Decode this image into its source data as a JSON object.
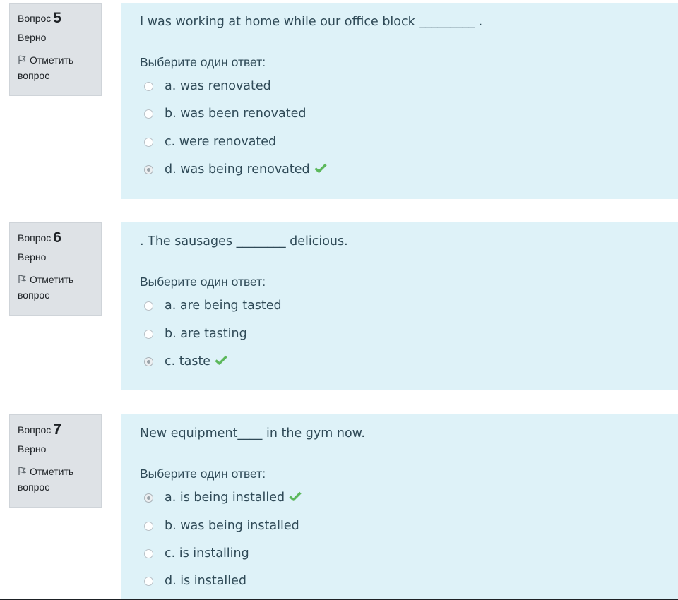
{
  "questions": [
    {
      "label": "Вопрос",
      "number": "5",
      "state": "Верно",
      "flag_label": "Отметить",
      "flag_label2": "вопрос",
      "text": "I was working at home while our office block   _________ .",
      "prompt": "Выберите один ответ:",
      "answers": [
        {
          "text": "a. was renovated",
          "checked": false,
          "correct": false
        },
        {
          "text": "b. was been renovated",
          "checked": false,
          "correct": false
        },
        {
          "text": "c. were renovated",
          "checked": false,
          "correct": false
        },
        {
          "text": "d. was being renovated",
          "checked": true,
          "correct": true
        }
      ]
    },
    {
      "label": "Вопрос",
      "number": "6",
      "state": "Верно",
      "flag_label": "Отметить",
      "flag_label2": "вопрос",
      "text": ". The sausages ________ delicious.",
      "prompt": "Выберите один ответ:",
      "answers": [
        {
          "text": "a. are being tasted",
          "checked": false,
          "correct": false
        },
        {
          "text": "b. are tasting",
          "checked": false,
          "correct": false
        },
        {
          "text": "c. taste",
          "checked": true,
          "correct": true
        }
      ]
    },
    {
      "label": "Вопрос",
      "number": "7",
      "state": "Верно",
      "flag_label": "Отметить",
      "flag_label2": "вопрос",
      "text": "New equipment____ in the gym now.",
      "prompt": "Выберите один ответ:",
      "answers": [
        {
          "text": "a. is being installed",
          "checked": true,
          "correct": true
        },
        {
          "text": "b. was being installed",
          "checked": false,
          "correct": false
        },
        {
          "text": "c. is installing",
          "checked": false,
          "correct": false
        },
        {
          "text": "d. is installed",
          "checked": false,
          "correct": false
        }
      ]
    }
  ],
  "colors": {
    "correct_check": "#5cb85c",
    "content_bg": "#def2f8",
    "info_bg": "#dee2e6"
  },
  "icons": {
    "flag": "flag-icon",
    "correct": "check-icon",
    "radio": "radio-icon"
  }
}
